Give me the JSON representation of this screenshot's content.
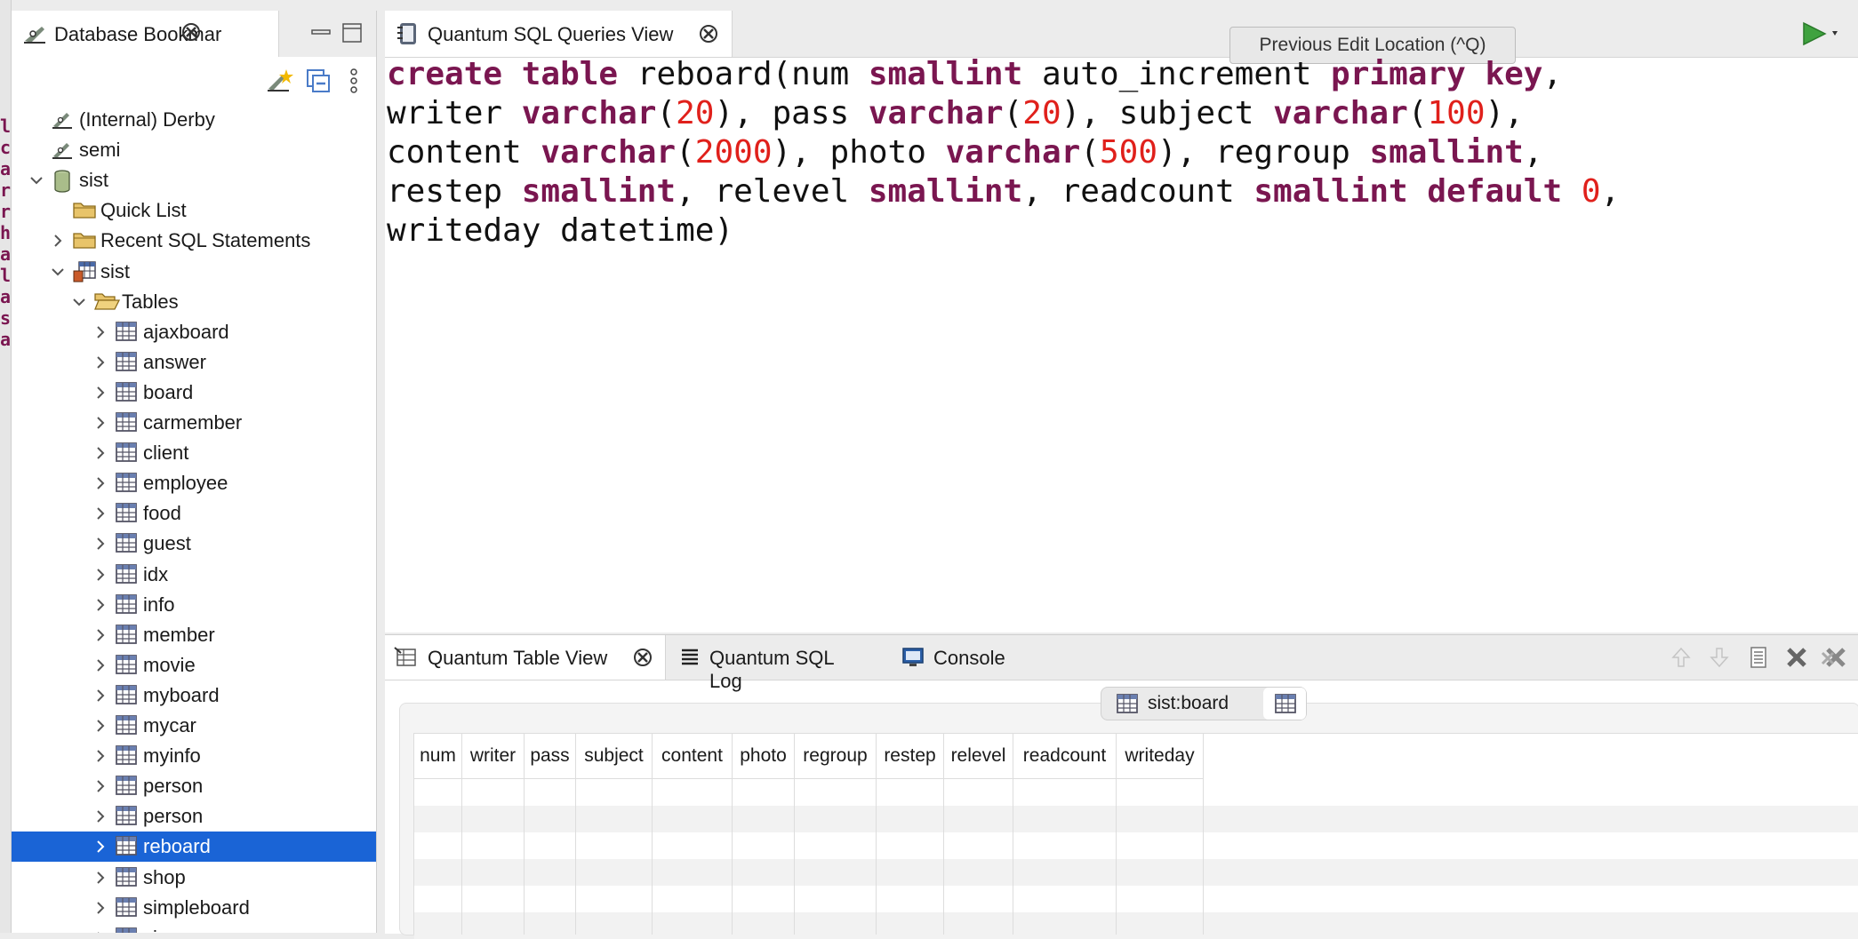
{
  "strip": {
    "chars": [
      "l",
      "c",
      "a",
      "r",
      "r",
      "h",
      "a",
      "l",
      "a",
      "s",
      "a"
    ]
  },
  "bookmarks": {
    "tab_label": "Database Bookmar",
    "tree": [
      {
        "label": "(Internal) Derby",
        "icon": "bookmark-icon",
        "level": 0,
        "expand": "none"
      },
      {
        "label": "semi",
        "icon": "bookmark-icon",
        "level": 0,
        "expand": "none"
      },
      {
        "label": "sist",
        "icon": "database-icon",
        "level": 0,
        "expand": "open"
      },
      {
        "label": "Quick List",
        "icon": "folder-icon",
        "level": 1,
        "expand": "none"
      },
      {
        "label": "Recent SQL Statements",
        "icon": "folder-icon",
        "level": 1,
        "expand": "closed"
      },
      {
        "label": "sist",
        "icon": "schema-icon",
        "level": 1,
        "expand": "open"
      },
      {
        "label": "Tables",
        "icon": "folder-open-icon",
        "level": 2,
        "expand": "open"
      },
      {
        "label": "ajaxboard",
        "icon": "table-icon",
        "level": 3,
        "expand": "closed"
      },
      {
        "label": "answer",
        "icon": "table-icon",
        "level": 3,
        "expand": "closed"
      },
      {
        "label": "board",
        "icon": "table-icon",
        "level": 3,
        "expand": "closed"
      },
      {
        "label": "carmember",
        "icon": "table-icon",
        "level": 3,
        "expand": "closed"
      },
      {
        "label": "client",
        "icon": "table-icon",
        "level": 3,
        "expand": "closed"
      },
      {
        "label": "employee",
        "icon": "table-icon",
        "level": 3,
        "expand": "closed"
      },
      {
        "label": "food",
        "icon": "table-icon",
        "level": 3,
        "expand": "closed"
      },
      {
        "label": "guest",
        "icon": "table-icon",
        "level": 3,
        "expand": "closed"
      },
      {
        "label": "idx",
        "icon": "table-icon",
        "level": 3,
        "expand": "closed"
      },
      {
        "label": "info",
        "icon": "table-icon",
        "level": 3,
        "expand": "closed"
      },
      {
        "label": "member",
        "icon": "table-icon",
        "level": 3,
        "expand": "closed"
      },
      {
        "label": "movie",
        "icon": "table-icon",
        "level": 3,
        "expand": "closed"
      },
      {
        "label": "myboard",
        "icon": "table-icon",
        "level": 3,
        "expand": "closed"
      },
      {
        "label": "mycar",
        "icon": "table-icon",
        "level": 3,
        "expand": "closed"
      },
      {
        "label": "myinfo",
        "icon": "table-icon",
        "level": 3,
        "expand": "closed"
      },
      {
        "label": "person",
        "icon": "table-icon",
        "level": 3,
        "expand": "closed"
      },
      {
        "label": "person",
        "icon": "table-icon",
        "level": 3,
        "expand": "closed"
      },
      {
        "label": "reboard",
        "icon": "table-icon",
        "level": 3,
        "expand": "closed",
        "selected": true
      },
      {
        "label": "shop",
        "icon": "table-icon",
        "level": 3,
        "expand": "closed"
      },
      {
        "label": "simpleboard",
        "icon": "table-icon",
        "level": 3,
        "expand": "closed"
      },
      {
        "label": "sinsang",
        "icon": "table-icon",
        "level": 3,
        "expand": "closed"
      }
    ]
  },
  "editor": {
    "tab_label": "Quantum SQL Queries View",
    "tooltip": "Previous Edit Location (^Q)",
    "sql_lines": [
      [
        [
          "kw",
          "create"
        ],
        [
          "t",
          " "
        ],
        [
          "kw",
          "table"
        ],
        [
          "t",
          " reboard(num "
        ],
        [
          "kw",
          "smallint"
        ],
        [
          "t",
          " auto_increment "
        ],
        [
          "kw",
          "primary"
        ],
        [
          "t",
          " "
        ],
        [
          "kw",
          "key"
        ],
        [
          "t",
          ","
        ]
      ],
      [
        [
          "t",
          "writer "
        ],
        [
          "kw",
          "varchar"
        ],
        [
          "t",
          "("
        ],
        [
          "num",
          "20"
        ],
        [
          "t",
          "), pass "
        ],
        [
          "kw",
          "varchar"
        ],
        [
          "t",
          "("
        ],
        [
          "num",
          "20"
        ],
        [
          "t",
          "), subject "
        ],
        [
          "kw",
          "varchar"
        ],
        [
          "t",
          "("
        ],
        [
          "num",
          "100"
        ],
        [
          "t",
          "),"
        ]
      ],
      [
        [
          "t",
          "content "
        ],
        [
          "kw",
          "varchar"
        ],
        [
          "t",
          "("
        ],
        [
          "num",
          "2000"
        ],
        [
          "t",
          "), photo "
        ],
        [
          "kw",
          "varchar"
        ],
        [
          "t",
          "("
        ],
        [
          "num",
          "500"
        ],
        [
          "t",
          "), regroup "
        ],
        [
          "kw",
          "smallint"
        ],
        [
          "t",
          ","
        ]
      ],
      [
        [
          "t",
          "restep "
        ],
        [
          "kw",
          "smallint"
        ],
        [
          "t",
          ", relevel "
        ],
        [
          "kw",
          "smallint"
        ],
        [
          "t",
          ", readcount "
        ],
        [
          "kw",
          "smallint"
        ],
        [
          "t",
          " "
        ],
        [
          "kw",
          "default"
        ],
        [
          "t",
          " "
        ],
        [
          "num",
          "0"
        ],
        [
          "t",
          ","
        ]
      ],
      [
        [
          "t",
          "writeday datetime)"
        ]
      ]
    ]
  },
  "bottom": {
    "tabs": [
      "Quantum Table View",
      "Quantum SQL Log",
      "Console"
    ],
    "table_name": "sist:board",
    "columns": [
      "num",
      "writer",
      "pass",
      "subject",
      "content",
      "photo",
      "regroup",
      "restep",
      "relevel",
      "readcount",
      "writeday"
    ]
  },
  "colors": {
    "keyword": "#7a1650",
    "number": "#e0201b",
    "selection": "#1a64d6"
  }
}
